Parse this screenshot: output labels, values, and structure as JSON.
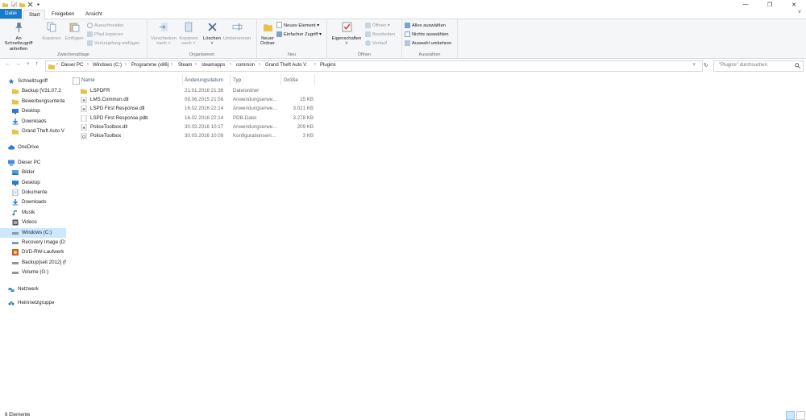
{
  "window": {
    "minimize": "—",
    "maximize": "❐",
    "close": "✕"
  },
  "tabs": [
    "Datei",
    "Start",
    "Freigeben",
    "Ansicht"
  ],
  "ribbon": {
    "zwischenablage": {
      "label": "Zwischenablage",
      "pin": "An Schnellzugriff anheften",
      "copy": "Kopieren",
      "paste": "Einfügen",
      "cut": "Ausschneiden",
      "copy_path": "Pfad kopieren",
      "paste_shortcut": "Verknüpfung einfügen"
    },
    "organisieren": {
      "label": "Organisieren",
      "move_to": "Verschieben nach ˅",
      "copy_to": "Kopieren nach ˅",
      "delete": "Löschen ˅",
      "rename": "Umbenennen"
    },
    "neu": {
      "label": "Neu",
      "new_folder": "Neuer Ordner",
      "new_item": "Neues Element ▾",
      "easy_access": "Einfacher Zugriff ▾"
    },
    "oeffnen": {
      "label": "Öffnen",
      "properties": "Eigenschaften ˅",
      "open": "Öffnen ▾",
      "edit": "Bearbeiten",
      "history": "Verlauf"
    },
    "auswaehlen": {
      "label": "Auswählen",
      "select_all": "Alles auswählen",
      "select_none": "Nichts auswählen",
      "invert": "Auswahl umkehren"
    }
  },
  "address": {
    "crumbs": [
      "Dieser PC",
      "Windows (C:)",
      "Programme (x86)",
      "Steam",
      "steamapps",
      "common",
      "Grand Theft Auto V",
      "Plugins"
    ],
    "search_placeholder": "\"Plugins\" durchsuchen"
  },
  "nav": {
    "items": [
      {
        "label": "Schnellzugriff",
        "icon": "star-icon",
        "indent": 0
      },
      {
        "label": "Backup [V31.07.2",
        "icon": "folder-icon",
        "indent": 1
      },
      {
        "label": "Bewerbungsunterla",
        "icon": "folder-icon",
        "indent": 1
      },
      {
        "label": "Desktop",
        "icon": "desktop-icon",
        "indent": 1
      },
      {
        "label": "Downloads",
        "icon": "download-icon",
        "indent": 1
      },
      {
        "label": "Grand Theft Auto V",
        "icon": "folder-icon",
        "indent": 1
      },
      {
        "label": "OneDrive",
        "icon": "cloud-icon",
        "indent": 0
      },
      {
        "label": "Dieser PC",
        "icon": "computer-icon",
        "indent": 0
      },
      {
        "label": "Bilder",
        "icon": "pictures-icon",
        "indent": 1
      },
      {
        "label": "Desktop",
        "icon": "desktop-icon",
        "indent": 1
      },
      {
        "label": "Dokumente",
        "icon": "documents-icon",
        "indent": 1
      },
      {
        "label": "Downloads",
        "icon": "download-icon",
        "indent": 1
      },
      {
        "label": "Musik",
        "icon": "music-icon",
        "indent": 1
      },
      {
        "label": "Videos",
        "icon": "video-icon",
        "indent": 1
      },
      {
        "label": "Windows (C:)",
        "icon": "drive-icon",
        "indent": 1
      },
      {
        "label": "Recovery Image (D:",
        "icon": "drive-icon",
        "indent": 1
      },
      {
        "label": "DVD-RW-Laufwerk",
        "icon": "dvd-icon",
        "indent": 1
      },
      {
        "label": "Backup[seit 2012] (F",
        "icon": "drive-icon",
        "indent": 1
      },
      {
        "label": "Volume (G:)",
        "icon": "drive-icon",
        "indent": 1
      },
      {
        "label": "Netzwerk",
        "icon": "network-icon",
        "indent": 0
      },
      {
        "label": "Heimnetzgruppe",
        "icon": "homegroup-icon",
        "indent": 0
      }
    ]
  },
  "columns": [
    "Name",
    "Änderungsdatum",
    "Typ",
    "Größe"
  ],
  "files": [
    {
      "name": "LSPDFR",
      "date": "21.01.2016 21:36",
      "type": "Dateiordner",
      "size": "",
      "icon": "folder-icon"
    },
    {
      "name": "LMS.Common.dll",
      "date": "08.06.2015 21:56",
      "type": "Anwendungserwe...",
      "size": "15 KB",
      "icon": "dll-file-icon"
    },
    {
      "name": "LSPD First Response.dll",
      "date": "16.02.2016 22:14",
      "type": "Anwendungserwe...",
      "size": "3.021 KB",
      "icon": "dll-file-icon"
    },
    {
      "name": "LSPD First Response.pdb",
      "date": "16.02.2016 22:14",
      "type": "PDB-Datei",
      "size": "3.278 KB",
      "icon": "file-icon"
    },
    {
      "name": "PoliceToolbox.dll",
      "date": "30.03.2016 10:17",
      "type": "Anwendungserwe...",
      "size": "209 KB",
      "icon": "dll-file-icon"
    },
    {
      "name": "PoliceToolbox",
      "date": "30.03.2016 10:09",
      "type": "Konfigurationsein...",
      "size": "3 KB",
      "icon": "config-file-icon"
    }
  ],
  "status": {
    "count": "6 Elemente"
  },
  "colors": {
    "accent": "#1979ca",
    "folder": "#e8c04a",
    "selected": "#cce8ff"
  }
}
